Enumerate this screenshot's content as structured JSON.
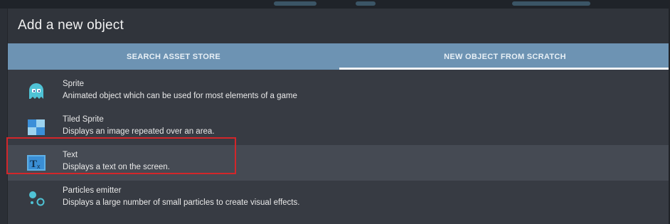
{
  "dialog": {
    "title": "Add a new object",
    "tabs": [
      {
        "label": "SEARCH ASSET STORE",
        "active": false
      },
      {
        "label": "NEW OBJECT FROM SCRATCH",
        "active": true
      }
    ]
  },
  "items": [
    {
      "name": "Sprite",
      "description": "Animated object which can be used for most elements of a game",
      "icon": "ghost-icon"
    },
    {
      "name": "Tiled Sprite",
      "description": "Displays an image repeated over an area.",
      "icon": "tiled-sprite-icon"
    },
    {
      "name": "Text",
      "description": "Displays a text on the screen.",
      "icon": "text-object-icon",
      "selected": true
    },
    {
      "name": "Particles emitter",
      "description": "Displays a large number of small particles to create visual effects.",
      "icon": "particles-icon"
    }
  ],
  "colors": {
    "accent": "#6d93b3",
    "highlight": "#d3262a",
    "background": "#373b43"
  }
}
